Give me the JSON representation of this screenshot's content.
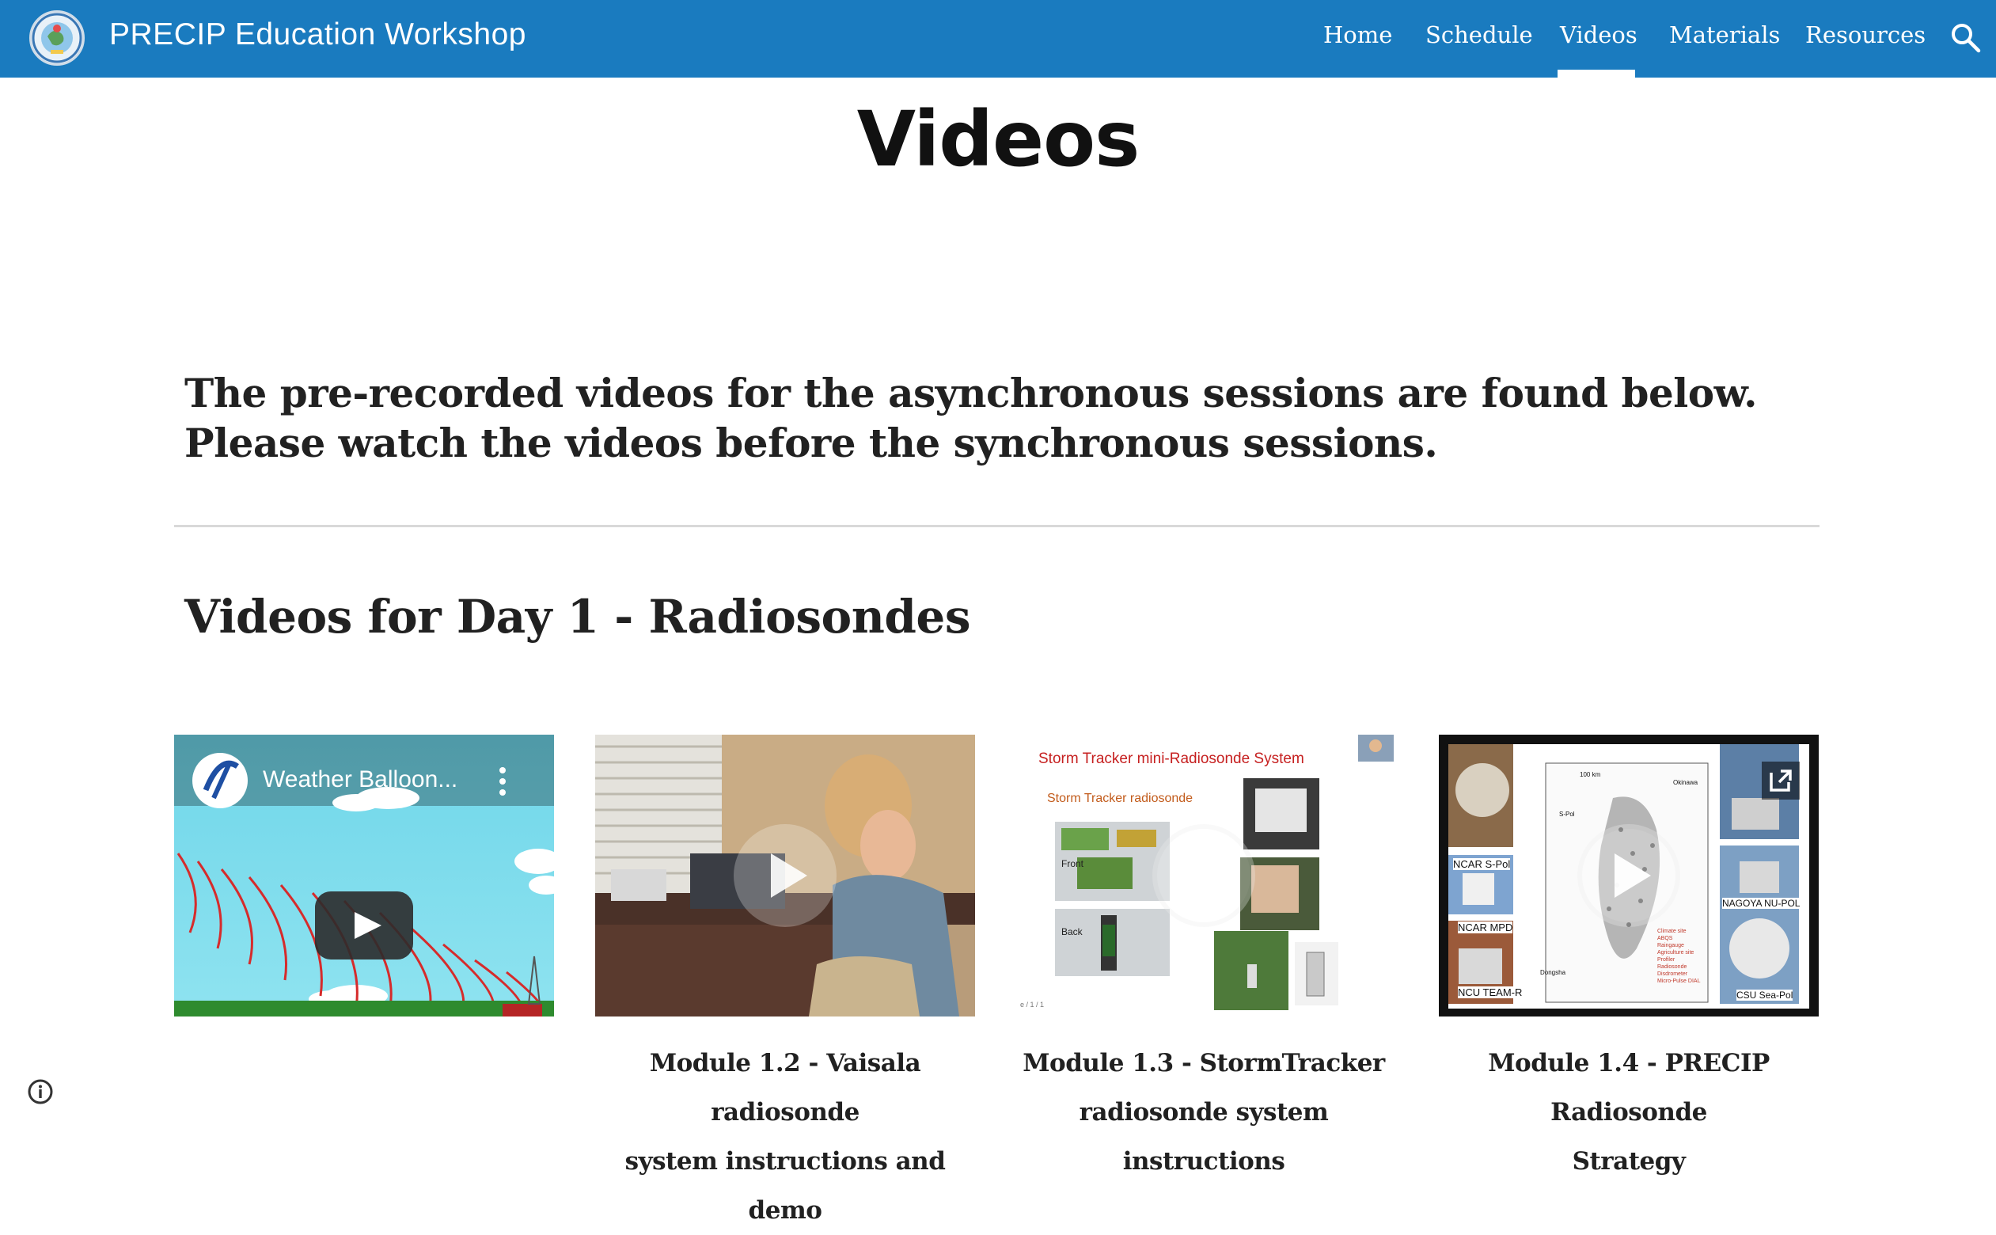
{
  "header": {
    "site_title": "PRECIP Education Workshop",
    "nav": [
      {
        "label": "Home",
        "active": false
      },
      {
        "label": "Schedule",
        "active": false
      },
      {
        "label": "Videos",
        "active": true
      },
      {
        "label": "Materials",
        "active": false
      },
      {
        "label": "Resources",
        "active": false
      }
    ],
    "search_icon": "search-icon",
    "bar_color": "#1a7bbf"
  },
  "page": {
    "title": "Videos",
    "intro": "The pre-recorded videos for the asynchronous sessions are found below. Please watch the videos before the synchronous sessions.",
    "day_heading": "Videos for Day 1 - Radiosondes"
  },
  "videos": [
    {
      "embed_title": "Weather Balloon...",
      "caption_line1": "",
      "caption_line2": ""
    },
    {
      "caption_line1": "Module 1.2 - Vaisala radiosonde",
      "caption_line2": "system instructions and demo"
    },
    {
      "slide_title": "Storm Tracker mini-Radiosonde System",
      "slide_subtitle": "Storm Tracker radiosonde",
      "slide_labels": [
        "Front",
        "Back"
      ],
      "slide_footer": "e / 1 / 1",
      "caption_line1": "Module 1.3 - StormTracker",
      "caption_line2": "radiosonde system instructions"
    },
    {
      "map_labels": [
        "NCAR S-Pol",
        "NCAR MPD",
        "NCU TEAM-R",
        "NAGOYA NU-POL",
        "CSU Sea-Pol",
        "100 km",
        "S-Pol",
        "Okinawa",
        "Dongsha"
      ],
      "legend": [
        "Climate site",
        "ABQS",
        "Raingauge",
        "Agriculture site",
        "Profiler",
        "Radiosonde",
        "Disdrometer",
        "Micro-Pulse DIAL"
      ],
      "caption_line1": "Module 1.4 - PRECIP Radiosonde",
      "caption_line2": "Strategy"
    }
  ],
  "footer": {
    "info_icon": "info-icon"
  }
}
